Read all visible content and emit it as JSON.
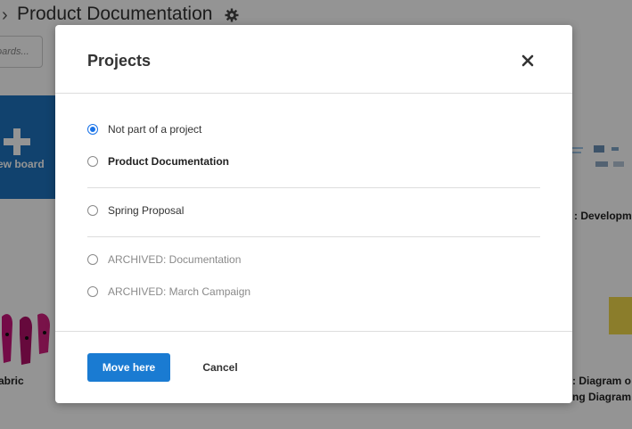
{
  "background": {
    "page_title": "Product Documentation",
    "search_placeholder": "oards...",
    "new_board_label": "ew board",
    "board_labels": {
      "left_bottom": "abric",
      "right_middle": ": Developm",
      "right_bottom_line1": ": Diagram o",
      "right_bottom_line2": "ng Diagram"
    },
    "colors": {
      "new_board_bg": "#1e73be"
    }
  },
  "modal": {
    "title": "Projects",
    "close_icon": "close-icon",
    "options": [
      {
        "label": "Not part of a project",
        "checked": true,
        "style": "normal"
      },
      {
        "label": "Product Documentation",
        "checked": false,
        "style": "bold"
      },
      {
        "label": "Spring Proposal",
        "checked": false,
        "style": "normal"
      },
      {
        "label": "ARCHIVED: Documentation",
        "checked": false,
        "style": "archived"
      },
      {
        "label": "ARCHIVED: March Campaign",
        "checked": false,
        "style": "archived"
      }
    ],
    "buttons": {
      "primary": "Move here",
      "cancel": "Cancel"
    },
    "colors": {
      "primary": "#1a7bd2",
      "radio_selected": "#1a73e8"
    }
  }
}
